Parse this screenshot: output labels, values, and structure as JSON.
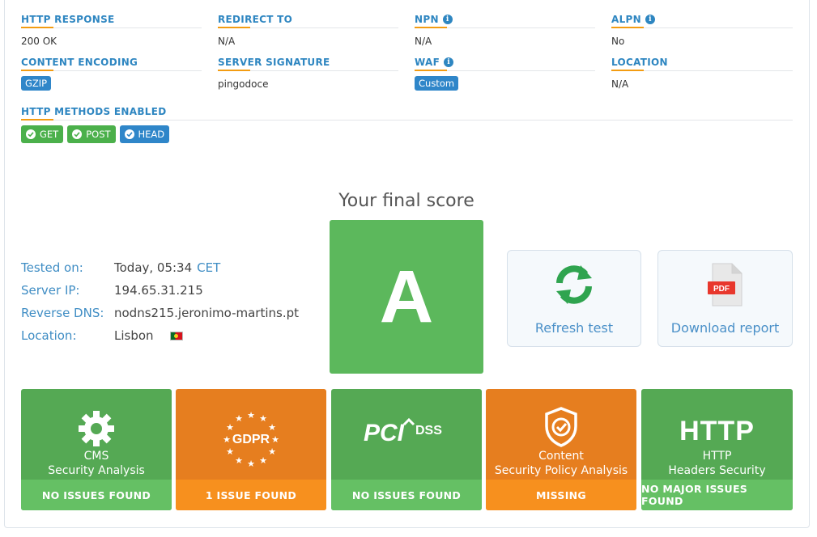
{
  "info": {
    "http_response": {
      "label": "HTTP RESPONSE",
      "value": "200 OK"
    },
    "redirect_to": {
      "label": "REDIRECT TO",
      "value": "N/A"
    },
    "npn": {
      "label": "NPN",
      "value": "N/A"
    },
    "alpn": {
      "label": "ALPN",
      "value": "No"
    },
    "content_encoding": {
      "label": "CONTENT ENCODING",
      "value": "GZIP"
    },
    "server_signature": {
      "label": "SERVER SIGNATURE",
      "value": "pingodoce"
    },
    "waf": {
      "label": "WAF",
      "value": "Custom"
    },
    "location": {
      "label": "LOCATION",
      "value": "N/A"
    },
    "http_methods": {
      "label": "HTTP METHODS ENABLED",
      "methods": [
        "GET",
        "POST",
        "HEAD"
      ]
    }
  },
  "score": {
    "title": "Your final score",
    "grade": "A",
    "grade_color": "#5cb85c"
  },
  "details": {
    "tested_on_label": "Tested on:",
    "tested_on_value": "Today, 05:34",
    "tested_on_tz": "CET",
    "server_ip_label": "Server IP:",
    "server_ip_value": "194.65.31.215",
    "reverse_dns_label": "Reverse DNS:",
    "reverse_dns_value": "nodns215.jeronimo-martins.pt",
    "location_label": "Location:",
    "location_value": "Lisbon",
    "location_flag": "portugal-flag-icon"
  },
  "actions": {
    "refresh": "Refresh test",
    "download": "Download report",
    "pdf_label": "PDF"
  },
  "tiles": [
    {
      "line1": "CMS",
      "line2": "Security Analysis",
      "status": "NO ISSUES FOUND",
      "color": "green"
    },
    {
      "logo_text": "GDPR",
      "status": "1 ISSUE FOUND",
      "color": "orange"
    },
    {
      "logo_text": "PCI",
      "logo_suffix": "DSS",
      "status": "NO ISSUES FOUND",
      "color": "green"
    },
    {
      "line1": "Content",
      "line2": "Security Policy Analysis",
      "status": "MISSING",
      "color": "orange"
    },
    {
      "logo_text": "HTTP",
      "line1": "HTTP",
      "line2": "Headers Security",
      "status": "NO MAJOR ISSUES FOUND",
      "color": "green"
    }
  ],
  "colors": {
    "label_blue": "#2e86c1",
    "underline_orange": "#f39c12",
    "green": "#55a954",
    "orange": "#e67e1f"
  }
}
